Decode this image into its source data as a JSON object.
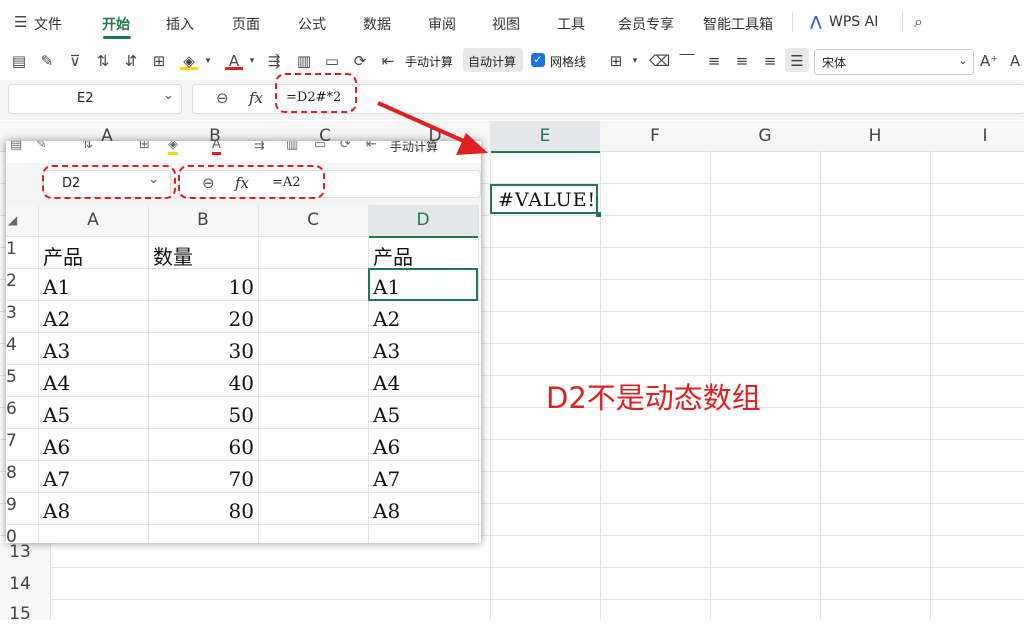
{
  "menu": {
    "file": "文件",
    "items": [
      "开始",
      "插入",
      "页面",
      "公式",
      "数据",
      "审阅",
      "视图",
      "工具",
      "会员专享",
      "智能工具箱"
    ],
    "wps_ai": "WPS AI"
  },
  "toolbar": {
    "manual_calc": "手动计算",
    "auto_calc": "自动计算",
    "gridlines": "网格线",
    "font_name": "宋体"
  },
  "formula_bar": {
    "cell_ref": "E2",
    "fx": "fx",
    "formula": "=D2#*2"
  },
  "sheet": {
    "columns": [
      "A",
      "B",
      "C",
      "D",
      "E",
      "F",
      "G",
      "H",
      "I"
    ],
    "row_numbers": [
      "13",
      "14",
      "15"
    ],
    "e2_value": "#VALUE!"
  },
  "inner": {
    "toolbar_manual_calc": "手动计算",
    "cell_ref": "D2",
    "fx": "fx",
    "formula": "=A2",
    "columns": [
      "A",
      "B",
      "C",
      "D"
    ],
    "row_numbers": [
      "1",
      "2",
      "3",
      "4",
      "5",
      "6",
      "7",
      "8",
      "9",
      "0"
    ],
    "header_product": "产品",
    "header_qty": "数量",
    "products": [
      "A1",
      "A2",
      "A3",
      "A4",
      "A5",
      "A6",
      "A7",
      "A8"
    ],
    "quantities": [
      "10",
      "20",
      "30",
      "40",
      "50",
      "60",
      "70",
      "80"
    ],
    "spill_header": "产品",
    "spill_values": [
      "A1",
      "A2",
      "A3",
      "A4",
      "A5",
      "A6",
      "A7",
      "A8"
    ]
  },
  "annotation": "D2不是动态数组",
  "colors": {
    "accent": "#1f7a4f",
    "annotation": "#e02020",
    "checkbox": "#1a73e8"
  }
}
